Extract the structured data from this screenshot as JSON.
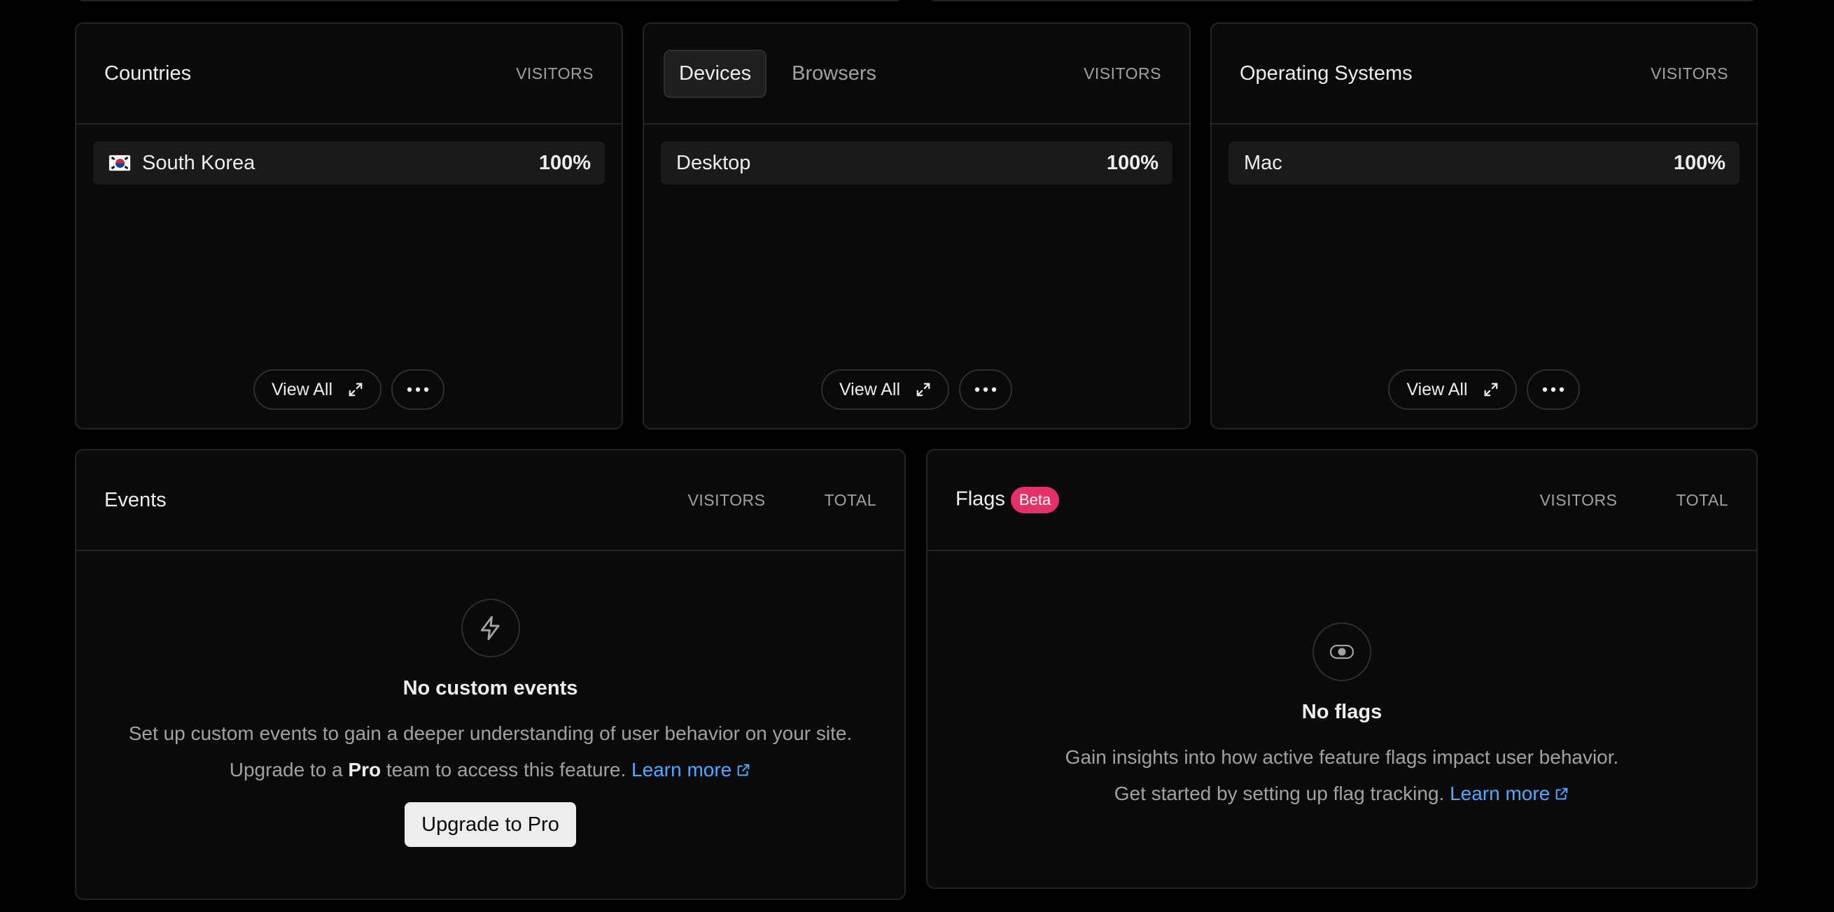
{
  "countries": {
    "title": "Countries",
    "col": "VISITORS",
    "rows": [
      {
        "label": "South Korea",
        "value": "100%"
      }
    ],
    "view_all": "View All"
  },
  "devices": {
    "tabs": [
      "Devices",
      "Browsers"
    ],
    "col": "VISITORS",
    "rows": [
      {
        "label": "Desktop",
        "value": "100%"
      }
    ],
    "view_all": "View All"
  },
  "os": {
    "title": "Operating Systems",
    "col": "VISITORS",
    "rows": [
      {
        "label": "Mac",
        "value": "100%"
      }
    ],
    "view_all": "View All"
  },
  "events": {
    "title": "Events",
    "cols": [
      "VISITORS",
      "TOTAL"
    ],
    "empty_title": "No custom events",
    "line1": "Set up custom events to gain a deeper understanding of user behavior on your site.",
    "line2_pre": "Upgrade to a ",
    "line2_bold": "Pro",
    "line2_post": " team to access this feature. ",
    "learn_more": "Learn more",
    "cta": "Upgrade to Pro",
    "icon": "bolt-icon"
  },
  "flags": {
    "title": "Flags",
    "badge": "Beta",
    "cols": [
      "VISITORS",
      "TOTAL"
    ],
    "empty_title": "No flags",
    "line1": "Gain insights into how active feature flags impact user behavior.",
    "line2": "Get started by setting up flag tracking. ",
    "learn_more": "Learn more",
    "icon": "toggle-icon"
  },
  "colors": {
    "background": "#000000",
    "card": "#0a0a0a",
    "border": "#242424",
    "link": "#52a8ff",
    "badge": "#e5316a"
  }
}
